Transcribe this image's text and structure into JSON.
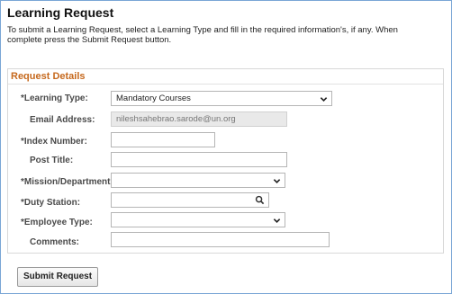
{
  "page": {
    "title": "Learning Request",
    "intro_line1": "To submit a Learning Request, select a Learning Type and fill in the required information's, if any. When",
    "intro_line2": "complete press the Submit Request button."
  },
  "section": {
    "title": "Request Details"
  },
  "fields": {
    "learning_type": {
      "label": "*Learning Type:",
      "value": "Mandatory Courses"
    },
    "email": {
      "label": "Email Address:",
      "value": "nileshsahebrao.sarode@un.org"
    },
    "index_number": {
      "label": "*Index Number:",
      "value": ""
    },
    "post_title": {
      "label": "Post Title:",
      "value": ""
    },
    "mission": {
      "label": "*Mission/Department:",
      "value": ""
    },
    "duty_station": {
      "label": "*Duty Station:",
      "value": ""
    },
    "employee_type": {
      "label": "*Employee Type:",
      "value": ""
    },
    "comments": {
      "label": "Comments:",
      "value": ""
    }
  },
  "actions": {
    "submit_label": "Submit Request"
  },
  "icons": {
    "dropdown": "chevron-down-icon",
    "lookup": "search-icon"
  },
  "colors": {
    "section_title": "#c6691e",
    "frame_border": "#7aa6d6"
  }
}
